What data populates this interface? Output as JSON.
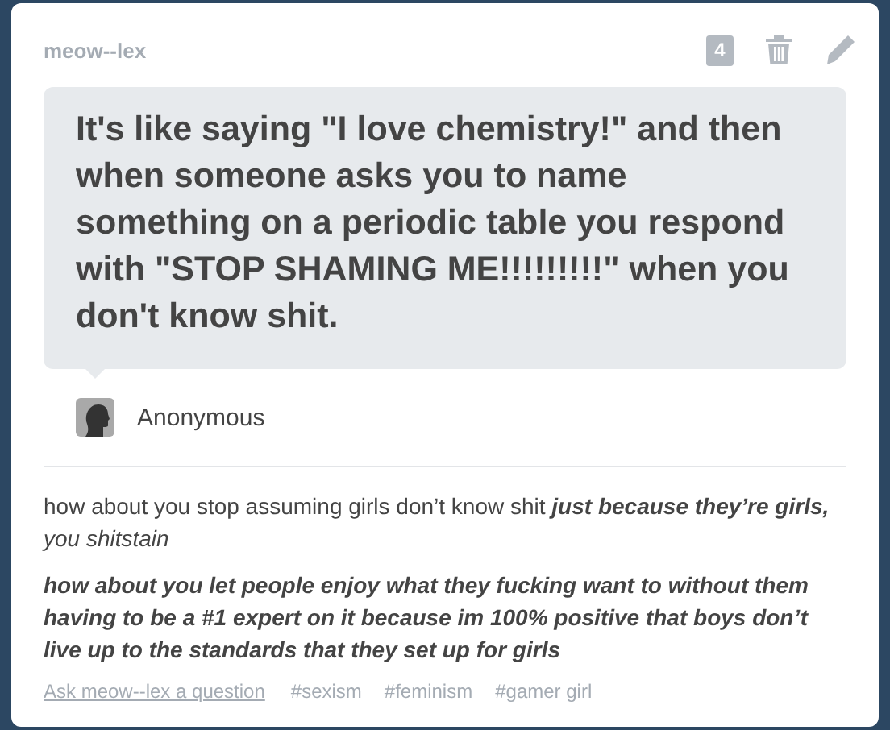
{
  "post": {
    "blog_name": "meow--lex",
    "notes_count": "4"
  },
  "question": {
    "text": "It's like saying \"I love chemistry!\" and then when someone asks you to name something on a periodic table you respond with \"STOP SHAMING ME!!!!!!!!!\" when you don't know shit.",
    "asker": "Anonymous"
  },
  "answer": [
    {
      "kind": "plain",
      "text": "how about you stop assuming girls don’t know shit **just because they’re girls,** *you shitstain*"
    },
    {
      "kind": "emphasis",
      "text": "how about you let people enjoy what they fucking want to without them having to be a #1 expert on it because im 100% positive that boys don’t live up to the standards that they set up for girls"
    }
  ],
  "footer": {
    "ask_link": "Ask meow--lex a question",
    "tags": [
      "#sexism",
      "#feminism",
      "#gamer girl"
    ]
  }
}
